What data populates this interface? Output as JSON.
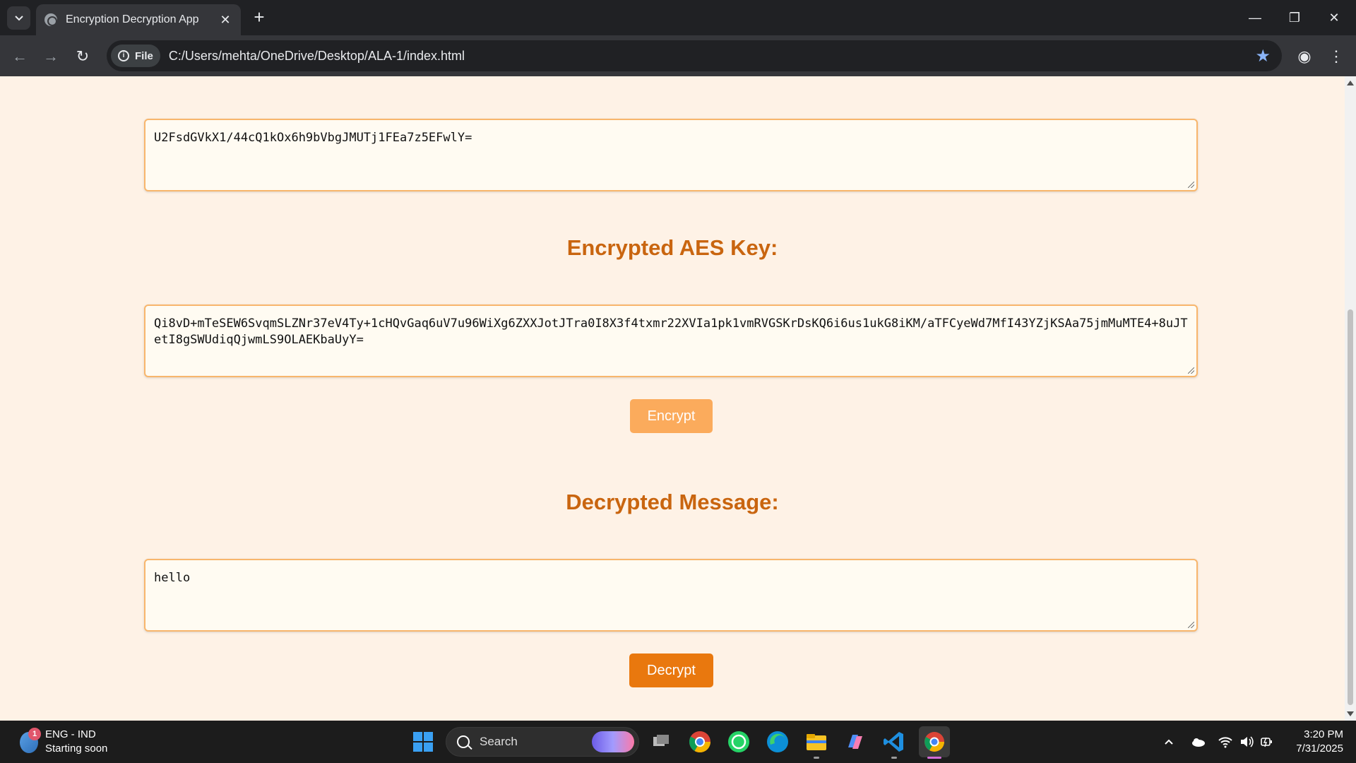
{
  "browser": {
    "tab_title": "Encryption Decryption App",
    "file_chip": "File",
    "url": "C:/Users/mehta/OneDrive/Desktop/ALA-1/index.html"
  },
  "page": {
    "encrypted_message_value": "U2FsdGVkX1/44cQ1kOx6h9bVbgJMUTj1FEa7z5EFwlY=",
    "aes_key_heading": "Encrypted AES Key:",
    "encrypted_aes_key_value": "Qi8vD+mTeSEW6SvqmSLZNr37eV4Ty+1cHQvGaq6uV7u96WiXg6ZXXJotJTra0I8X3f4txmr22XVIa1pk1vmRVGSKrDsKQ6i6us1ukG8iKM/aTFCyeWd7MfI43YZjKSAa75jmMuMTE4+8uJTetI8gSWUdiqQjwmLS9OLAEKbaUyY=",
    "encrypt_button": "Encrypt",
    "decrypted_heading": "Decrypted Message:",
    "decrypted_message_value": "hello",
    "decrypt_button": "Decrypt"
  },
  "taskbar": {
    "weather_badge": "1",
    "weather_line1": "ENG - IND",
    "weather_line2": "Starting soon",
    "search_label": "Search",
    "time": "3:20 PM",
    "date": "7/31/2025",
    "apps": [
      "task-view-icon",
      "chrome-icon",
      "whatsapp-icon",
      "edge-icon",
      "file-explorer-icon",
      "copilot-icon",
      "vscode-icon",
      "chrome-active-icon"
    ]
  },
  "colors": {
    "page_bg": "#fef2e6",
    "heading": "#c9650f",
    "field_border": "#f8b66c",
    "encrypt_button": "#fbab5c",
    "decrypt_button": "#e9780e"
  }
}
